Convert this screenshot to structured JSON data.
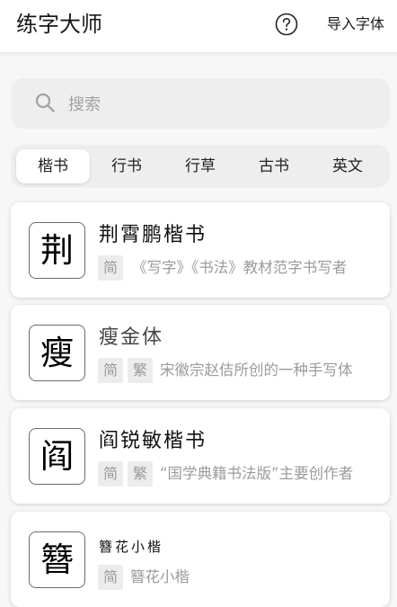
{
  "header": {
    "title": "练字大师",
    "import_label": "导入字体"
  },
  "search": {
    "placeholder": "搜索"
  },
  "tabs": [
    "楷书",
    "行书",
    "行草",
    "古书",
    "英文"
  ],
  "active_tab": "楷书",
  "fonts": [
    {
      "preview": "荆",
      "name": "荆霄鹏楷书",
      "tags": [
        "简"
      ],
      "description": "《写字》《书法》教材范字书写者"
    },
    {
      "preview": "瘦",
      "name": "瘦金体",
      "tags": [
        "简",
        "繁"
      ],
      "description": "宋徽宗赵佶所创的一种手写体"
    },
    {
      "preview": "阎",
      "name": "阎锐敏楷书",
      "tags": [
        "简",
        "繁"
      ],
      "description": "“国学典籍书法版”主要创作者"
    },
    {
      "preview": "簪",
      "name": "簪花小楷",
      "tags": [
        "简"
      ],
      "description": "簪花小楷"
    }
  ]
}
